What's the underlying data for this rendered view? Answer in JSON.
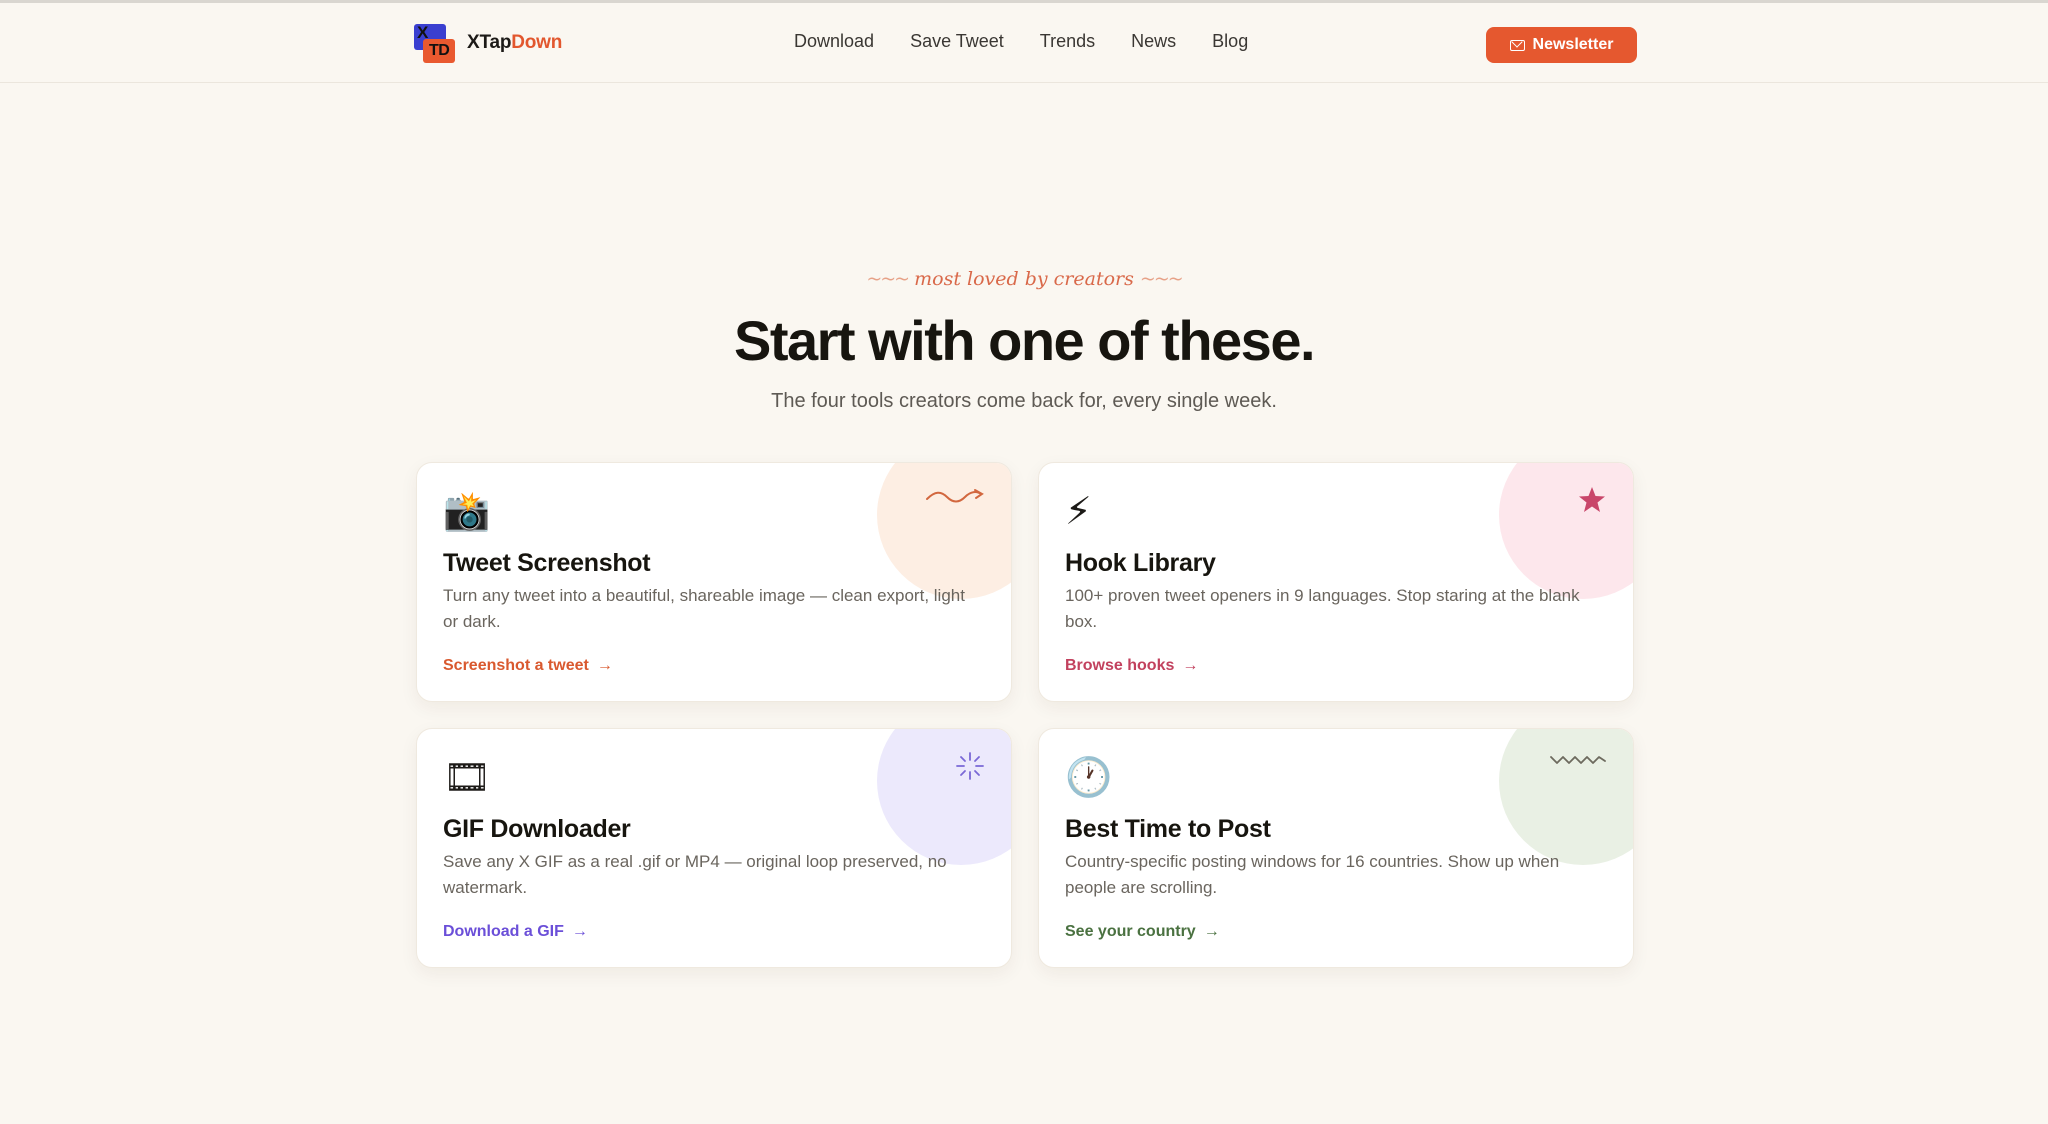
{
  "brand": {
    "name_part1": "XTap",
    "name_part2": "Down",
    "logo_x": "X",
    "logo_td": "TD"
  },
  "nav": {
    "items": [
      "Download",
      "Save Tweet",
      "Trends",
      "News",
      "Blog"
    ]
  },
  "newsletter": {
    "label": "Newsletter"
  },
  "hero": {
    "eyebrow": "most loved by creators",
    "squiggle": "~~~",
    "title": "Start with one of these.",
    "subtitle": "The four tools creators come back for, every single week."
  },
  "cards": [
    {
      "emoji": "📸",
      "title": "Tweet Screenshot",
      "description": "Turn any tweet into a beautiful, shareable image — clean export, light or dark.",
      "cta": "Screenshot a tweet",
      "accent": "#d9592f",
      "blob": "#fdeee3"
    },
    {
      "emoji": "⚡",
      "title": "Hook Library",
      "description": "100+ proven tweet openers in 9 languages. Stop staring at the blank box.",
      "cta": "Browse hooks",
      "accent": "#c2415e",
      "blob": "#fde7ec"
    },
    {
      "emoji": "🎞",
      "title": "GIF Downloader",
      "description": "Save any X GIF as a real .gif or MP4 — original loop preserved, no watermark.",
      "cta": "Download a GIF",
      "accent": "#6b4fd8",
      "blob": "#ece9fc"
    },
    {
      "emoji": "🕐",
      "title": "Best Time to Post",
      "description": "Country-specific posting windows for 16 countries. Show up when people are scrolling.",
      "cta": "See your country",
      "accent": "#4a7140",
      "blob": "#e9f0e4"
    }
  ],
  "arrow": "→"
}
